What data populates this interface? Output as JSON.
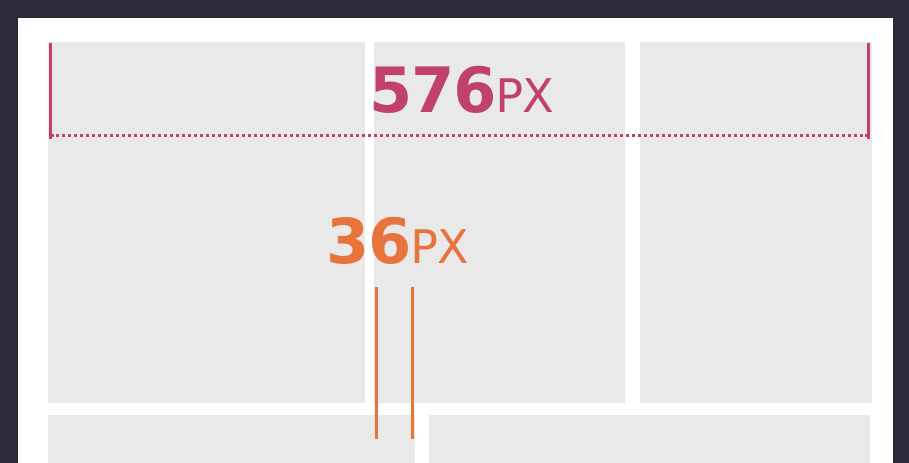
{
  "colors": {
    "frame": "#2a2b36",
    "canvas": "#ffffff",
    "cell": "#e9e9e9",
    "width_annotation": "#c0406e",
    "gutter_annotation": "#e8733c"
  },
  "annotations": {
    "container_width": {
      "value": "576",
      "unit": "PX"
    },
    "gutter_width": {
      "value": "36",
      "unit": "PX"
    }
  }
}
